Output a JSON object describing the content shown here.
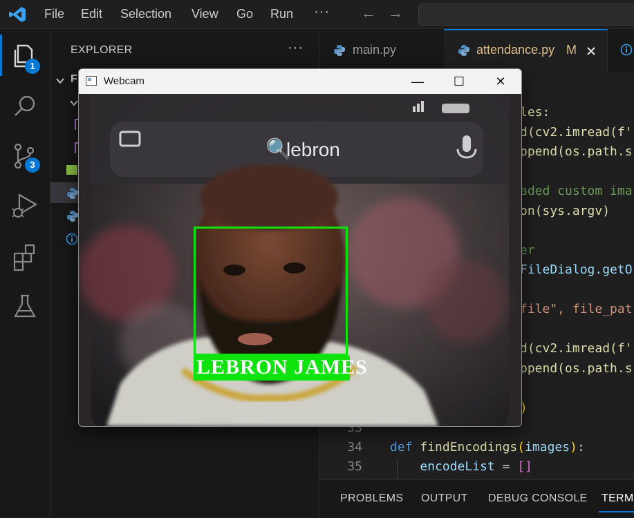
{
  "menubar": {
    "items": [
      "File",
      "Edit",
      "Selection",
      "View",
      "Go",
      "Run"
    ],
    "more": "···",
    "back": "←",
    "forward": "→"
  },
  "activitybar": {
    "explorer_badge": "1",
    "source_control_badge": "3"
  },
  "sidebar": {
    "title": "EXPLORER",
    "more": "···"
  },
  "tabs": [
    {
      "label": "main.py",
      "active": false
    },
    {
      "label": "attendance.py",
      "modified": "M",
      "active": true
    }
  ],
  "editor": {
    "lines": [
      {
        "num": "33",
        "code": ""
      },
      {
        "num": "34",
        "code": "def findEncodings(images):"
      },
      {
        "num": "35",
        "code": "    encodeList = []"
      }
    ],
    "visible_fragments": {
      "l1": "les:",
      "l2a": "d(cv2.imread(f'",
      "l3a": "ppend(os.path.s",
      "l4": "aded custom ima",
      "l5a": "on(sys.argv)",
      "l6": "er",
      "l7": "FileDialog.getO",
      "l8a": "file\", file_pat",
      "l9a": "d(cv2.imread(f'",
      "l10a": "ppend(os.path.s",
      "l11": ")"
    }
  },
  "panel": {
    "tabs": [
      "PROBLEMS",
      "OUTPUT",
      "DEBUG CONSOLE",
      "TERMI"
    ]
  },
  "webcam": {
    "title": "Webcam",
    "minimize": "—",
    "maximize": "☐",
    "close": "✕",
    "search_text": "lebron",
    "face_label": "LEBRON JAMES",
    "box_color": "#0ee30e"
  },
  "colors": {
    "accent": "#0078d4",
    "editor_bg": "#1f1f1f",
    "sidebar_bg": "#181818",
    "modified": "#e2c08d"
  }
}
